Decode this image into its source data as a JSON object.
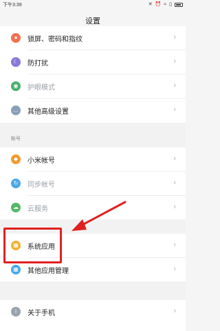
{
  "status_bar": {
    "time": "下午3:39",
    "icons": [
      "mute-icon",
      "alarm-icon",
      "wifi-icon",
      "sim-icon",
      "battery-icon"
    ]
  },
  "header": {
    "title": "设置"
  },
  "rows": [
    {
      "label": "锁屏、密码和指纹",
      "icon": "lock-icon",
      "color": "#f07050"
    },
    {
      "label": "防打扰",
      "icon": "moon-icon",
      "color": "#8a78d8"
    },
    {
      "label": "护眼模式",
      "icon": "eye-icon",
      "color": "#4caf70"
    },
    {
      "label": "其他高级设置",
      "icon": "more-icon",
      "color": "#8aa0b8"
    }
  ],
  "section_accounts": {
    "title": "帐号"
  },
  "account_rows": [
    {
      "label": "小米帐号",
      "icon": "mi-account-icon",
      "color": "#f29a2e"
    },
    {
      "label": "同步帐号",
      "icon": "sync-icon",
      "color": "#4aa8e8"
    },
    {
      "label": "云服务",
      "icon": "cloud-icon",
      "color": "#52b96a"
    }
  ],
  "app_rows": [
    {
      "label": "系统应用",
      "icon": "apps-icon",
      "color": "#f2b233"
    },
    {
      "label": "其他应用管理",
      "icon": "grid-icon",
      "color": "#4aa8e8"
    }
  ],
  "about_row": {
    "label": "关于手机",
    "icon": "info-icon",
    "color": "#9aa3ad"
  },
  "chevron": "›",
  "annotation": {
    "arrow_color": "#e02020",
    "box_color": "#e02020"
  }
}
